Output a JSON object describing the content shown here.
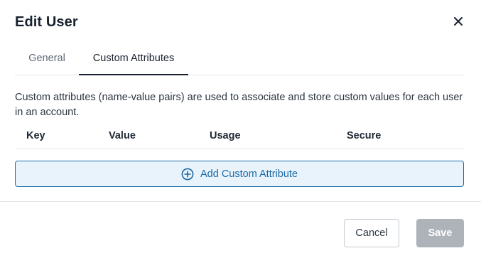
{
  "dialog": {
    "title": "Edit User",
    "close_icon": "close-icon"
  },
  "tabs": [
    {
      "label": "General",
      "active": false
    },
    {
      "label": "Custom Attributes",
      "active": true
    }
  ],
  "description": "Custom attributes (name-value pairs) are used to associate and store custom values for each user in an account.",
  "table": {
    "columns": [
      "Key",
      "Value",
      "Usage",
      "Secure"
    ],
    "rows": []
  },
  "add_attribute": {
    "label": "Add Custom Attribute",
    "icon": "plus-circle-icon"
  },
  "footer": {
    "cancel_label": "Cancel",
    "save_label": "Save",
    "save_disabled": true
  },
  "colors": {
    "accent": "#1b6aa5",
    "accent_bg": "#e9f3fb",
    "disabled_button": "#aeb3ba",
    "text": "#1a2330"
  }
}
